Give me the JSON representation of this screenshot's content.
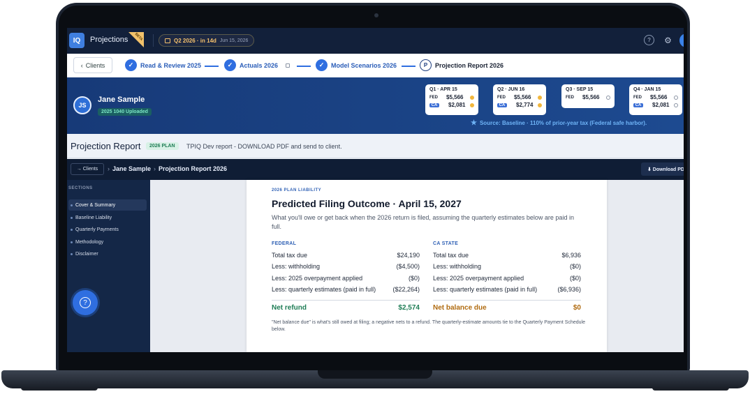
{
  "app": {
    "logo_text": "IQ",
    "title": "Projections",
    "beta": "BETA",
    "quarter_pill": {
      "label": "Q2 2026 · in 14d",
      "date": "Jun 15, 2026"
    }
  },
  "stepper": {
    "back_label": "Clients",
    "steps": [
      {
        "label": "Read & Review 2025",
        "state": "done"
      },
      {
        "label": "Actuals 2026",
        "state": "done"
      },
      {
        "label": "Model Scenarios 2026",
        "state": "done"
      },
      {
        "label": "Projection Report 2026",
        "state": "current",
        "marker": "P"
      }
    ]
  },
  "client": {
    "initials": "JS",
    "name": "Jane Sample",
    "badge": "2025 1040 Uploaded",
    "quarters": [
      {
        "title": "Q1 · APR 15",
        "fed": "$5,566",
        "ca": "$2,081",
        "fed_status": "pending",
        "ca_status": "pending"
      },
      {
        "title": "Q2 · JUN 16",
        "fed": "$5,566",
        "ca": "$2,774",
        "fed_status": "pending",
        "ca_status": "pending"
      },
      {
        "title": "Q3 · SEP 15",
        "fed": "$5,566",
        "ca": null,
        "fed_status": "open",
        "ca_status": null
      },
      {
        "title": "Q4 · JAN 15",
        "fed": "$5,566",
        "ca": "$2,081",
        "fed_status": "open",
        "ca_status": "open"
      }
    ],
    "fed_tag": "FED",
    "ca_tag": "CA",
    "source": "Source: Baseline · 110% of prior-year tax (Federal safe harbor)."
  },
  "report_header": {
    "title": "Projection Report",
    "badge": "2026 PLAN",
    "note": "TPIQ Dev report - DOWNLOAD PDF and send to client."
  },
  "breadcrumb": {
    "back": "→ Clients",
    "client": "Jane Sample",
    "page": "Projection Report 2026",
    "download": "⬇ Download PDF"
  },
  "sidebar": {
    "section_label": "SECTIONS",
    "items": [
      "Cover & Summary",
      "Baseline Liability",
      "Quarterly Payments",
      "Methodology",
      "Disclaimer"
    ]
  },
  "document": {
    "kicker": "2026 PLAN LIABILITY",
    "title": "Predicted Filing Outcome · April 15, 2027",
    "subtitle": "What you'll owe or get back when the 2026 return is filed, assuming the quarterly estimates below are paid in full.",
    "federal": {
      "heading": "FEDERAL",
      "rows": [
        {
          "label": "Total tax due",
          "value": "$24,190"
        },
        {
          "label": "Less: withholding",
          "value": "($4,500)"
        },
        {
          "label": "Less: 2025 overpayment applied",
          "value": "($0)"
        },
        {
          "label": "Less: quarterly estimates (paid in full)",
          "value": "($22,264)"
        }
      ],
      "total_label": "Net refund",
      "total_value": "$2,574"
    },
    "state": {
      "heading": "CA STATE",
      "rows": [
        {
          "label": "Total tax due",
          "value": "$6,936"
        },
        {
          "label": "Less: withholding",
          "value": "($0)"
        },
        {
          "label": "Less: 2025 overpayment applied",
          "value": "($0)"
        },
        {
          "label": "Less: quarterly estimates (paid in full)",
          "value": "($6,936)"
        }
      ],
      "total_label": "Net balance due",
      "total_value": "$0"
    },
    "footnote": "\"Net balance due\" is what's still owed at filing; a negative nets to a refund. The quarterly-estimate amounts tie to the Quarterly Payment Schedule below."
  }
}
